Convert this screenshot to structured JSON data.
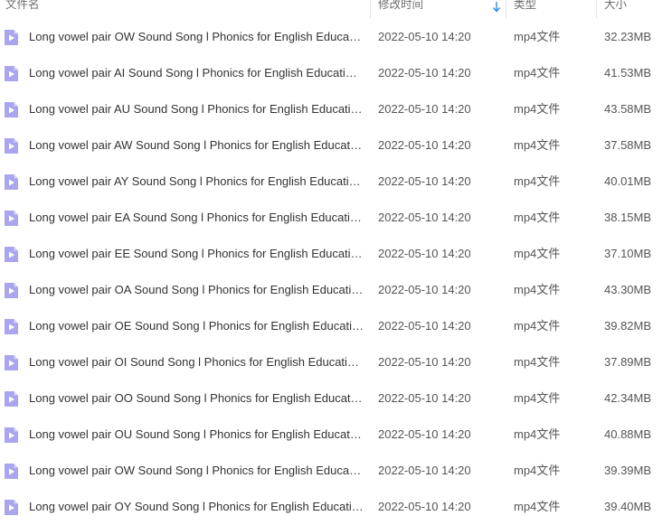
{
  "columns": {
    "name": "文件名",
    "modified": "修改时间",
    "type": "类型",
    "size": "大小"
  },
  "colors": {
    "icon_fill": "#a9a6ef",
    "icon_fold": "#d6d4f8",
    "sort_arrow": "#2e8be6"
  },
  "icons": {
    "file": "video-file-icon",
    "sort": "sort-down-arrow-icon"
  },
  "files": [
    {
      "name": "Long vowel pair  OW Sound Song l Phonics for English Educa…",
      "modified": "2022-05-10 14:20",
      "type": "mp4文件",
      "size": "32.23MB"
    },
    {
      "name": "Long vowel pair AI Sound Song l Phonics for English Educati…",
      "modified": "2022-05-10 14:20",
      "type": "mp4文件",
      "size": "41.53MB"
    },
    {
      "name": "Long vowel pair AU Sound Song l Phonics for English Educati…",
      "modified": "2022-05-10 14:20",
      "type": "mp4文件",
      "size": "43.58MB"
    },
    {
      "name": "Long vowel pair AW Sound Song l Phonics for English Educat…",
      "modified": "2022-05-10 14:20",
      "type": "mp4文件",
      "size": "37.58MB"
    },
    {
      "name": "Long vowel pair AY Sound Song l Phonics for English Educati…",
      "modified": "2022-05-10 14:20",
      "type": "mp4文件",
      "size": "40.01MB"
    },
    {
      "name": "Long vowel pair EA Sound Song l Phonics for English Educati…",
      "modified": "2022-05-10 14:20",
      "type": "mp4文件",
      "size": "38.15MB"
    },
    {
      "name": "Long vowel pair EE Sound Song l Phonics for English Educati…",
      "modified": "2022-05-10 14:20",
      "type": "mp4文件",
      "size": "37.10MB"
    },
    {
      "name": "Long vowel pair OA Sound Song l Phonics for English Educati…",
      "modified": "2022-05-10 14:20",
      "type": "mp4文件",
      "size": "43.30MB"
    },
    {
      "name": "Long vowel pair OE Sound Song l Phonics for English Educati…",
      "modified": "2022-05-10 14:20",
      "type": "mp4文件",
      "size": "39.82MB"
    },
    {
      "name": "Long vowel pair OI Sound Song l Phonics for English Educati…",
      "modified": "2022-05-10 14:20",
      "type": "mp4文件",
      "size": "37.89MB"
    },
    {
      "name": "Long vowel pair OO Sound Song l Phonics for English Educat…",
      "modified": "2022-05-10 14:20",
      "type": "mp4文件",
      "size": "42.34MB"
    },
    {
      "name": "Long vowel pair OU Sound Song l Phonics for English Educat…",
      "modified": "2022-05-10 14:20",
      "type": "mp4文件",
      "size": "40.88MB"
    },
    {
      "name": "Long vowel pair OW Sound Song l Phonics for English Educa…",
      "modified": "2022-05-10 14:20",
      "type": "mp4文件",
      "size": "39.39MB"
    },
    {
      "name": "Long vowel pair OY Sound Song l Phonics for English Educati…",
      "modified": "2022-05-10 14:20",
      "type": "mp4文件",
      "size": "39.40MB"
    }
  ]
}
